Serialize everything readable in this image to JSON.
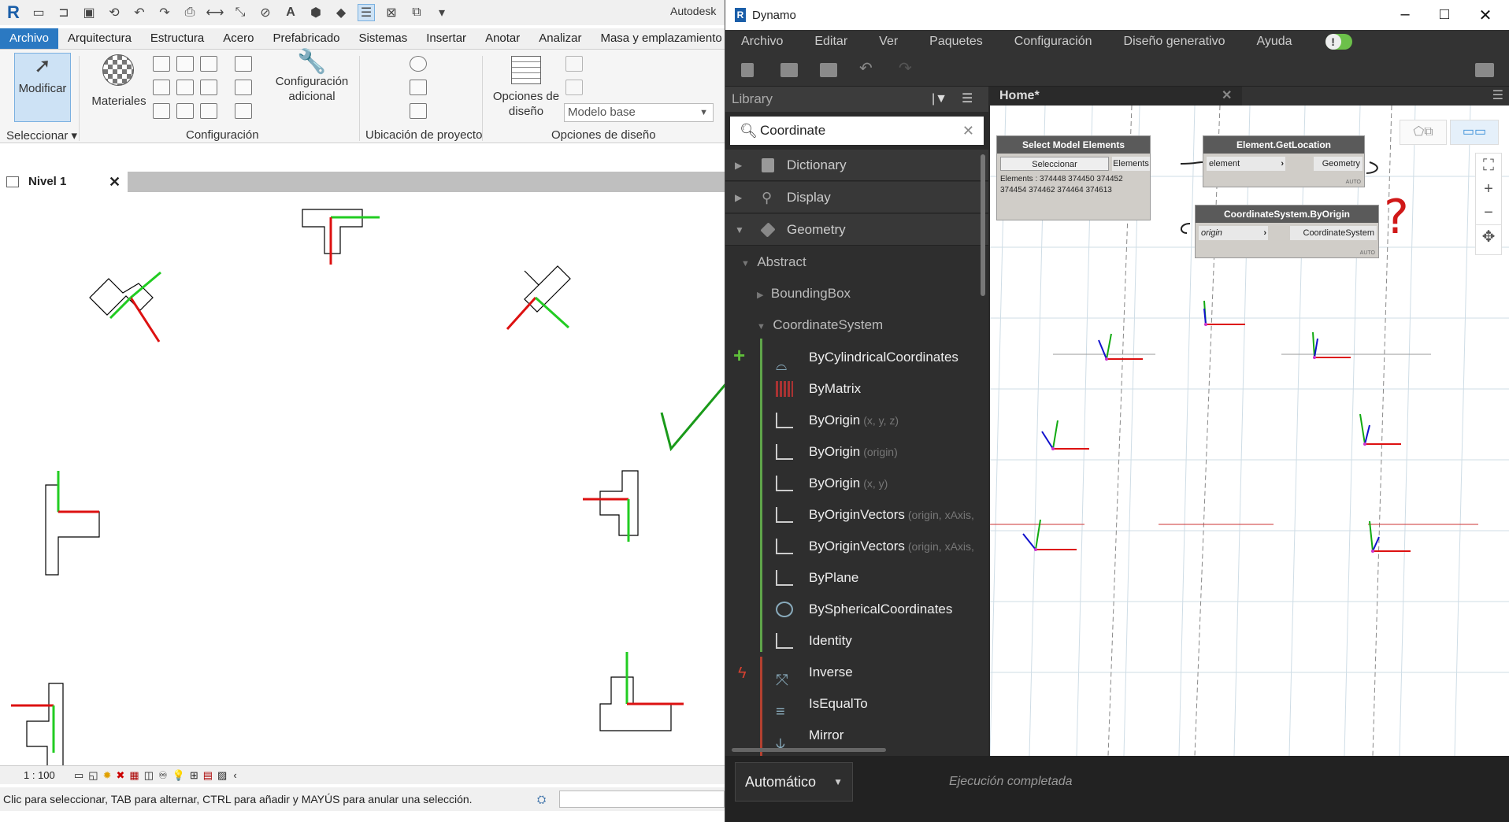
{
  "revit": {
    "app_title": "Autodesk",
    "qat_icons": [
      "revit-logo-icon",
      "open-icon",
      "open-icon",
      "save-icon",
      "sync-icon",
      "undo-icon",
      "redo-icon",
      "print-icon",
      "measure-icon",
      "dimension-icon",
      "tag-icon",
      "text-icon",
      "3d-view-icon",
      "section-icon",
      "thin-lines-icon",
      "close-hidden-icon",
      "switch-windows-icon",
      "dropdown-icon"
    ],
    "tabs": [
      {
        "label": "Archivo",
        "active": true
      },
      {
        "label": "Arquitectura"
      },
      {
        "label": "Estructura"
      },
      {
        "label": "Acero"
      },
      {
        "label": "Prefabricado"
      },
      {
        "label": "Sistemas"
      },
      {
        "label": "Insertar"
      },
      {
        "label": "Anotar"
      },
      {
        "label": "Analizar"
      },
      {
        "label": "Masa y emplazamiento"
      }
    ],
    "ribbon": {
      "modificar": "Modificar",
      "materiales": "Materiales",
      "config_adicional_1": "Configuración",
      "config_adicional_2": "adicional",
      "opciones_diseno_1": "Opciones de",
      "opciones_diseno_2": "diseño",
      "modelo_base": "Modelo base",
      "panels": {
        "seleccionar": "Seleccionar",
        "configuracion": "Configuración",
        "ubicacion": "Ubicación de proyecto",
        "opciones": "Opciones de diseño"
      }
    },
    "view_tab": "Nivel 1",
    "view_tab_close": "✕",
    "scale": "1 : 100",
    "status": "Clic para seleccionar, TAB para alternar, CTRL para añadir y MAYÚS para anular una selección."
  },
  "dynamo": {
    "title": "Dynamo",
    "menu": [
      "Archivo",
      "Editar",
      "Ver",
      "Paquetes",
      "Configuración",
      "Diseño generativo",
      "Ayuda"
    ],
    "library": {
      "header": "Library",
      "search_value": "Coordinate",
      "categories": [
        "Dictionary",
        "Display",
        "Geometry"
      ],
      "abstract": "Abstract",
      "boundingbox": "BoundingBox",
      "coordinate_system": "CoordinateSystem",
      "nodes": [
        {
          "label": "ByCylindricalCoordinates",
          "hint": ""
        },
        {
          "label": "ByMatrix",
          "hint": ""
        },
        {
          "label": "ByOrigin",
          "hint": "(x, y, z)"
        },
        {
          "label": "ByOrigin",
          "hint": "(origin)"
        },
        {
          "label": "ByOrigin",
          "hint": "(x, y)"
        },
        {
          "label": "ByOriginVectors",
          "hint": "(origin, xAxis,"
        },
        {
          "label": "ByOriginVectors",
          "hint": "(origin, xAxis,"
        },
        {
          "label": "ByPlane",
          "hint": ""
        },
        {
          "label": "BySphericalCoordinates",
          "hint": ""
        },
        {
          "label": "Identity",
          "hint": ""
        },
        {
          "label": "Inverse",
          "hint": ""
        },
        {
          "label": "IsEqualTo",
          "hint": ""
        },
        {
          "label": "Mirror",
          "hint": ""
        }
      ]
    },
    "workspace": {
      "tab": "Home*",
      "tab_close": "✕",
      "nodes": {
        "select": {
          "title": "Select Model Elements",
          "button": "Seleccionar",
          "output": "Elements",
          "value_1": "Elements : 374448 374450 374452",
          "value_2": "374454 374462 374464 374613"
        },
        "getlocation": {
          "title": "Element.GetLocation",
          "input": "element",
          "output": "Geometry",
          "auto": "AUTO"
        },
        "byorigin": {
          "title": "CoordinateSystem.ByOrigin",
          "input": "origin",
          "output": "CoordinateSystem",
          "auto": "AUTO"
        }
      },
      "annotation": "?"
    },
    "run_mode": "Automático",
    "run_status": "Ejecución completada"
  }
}
